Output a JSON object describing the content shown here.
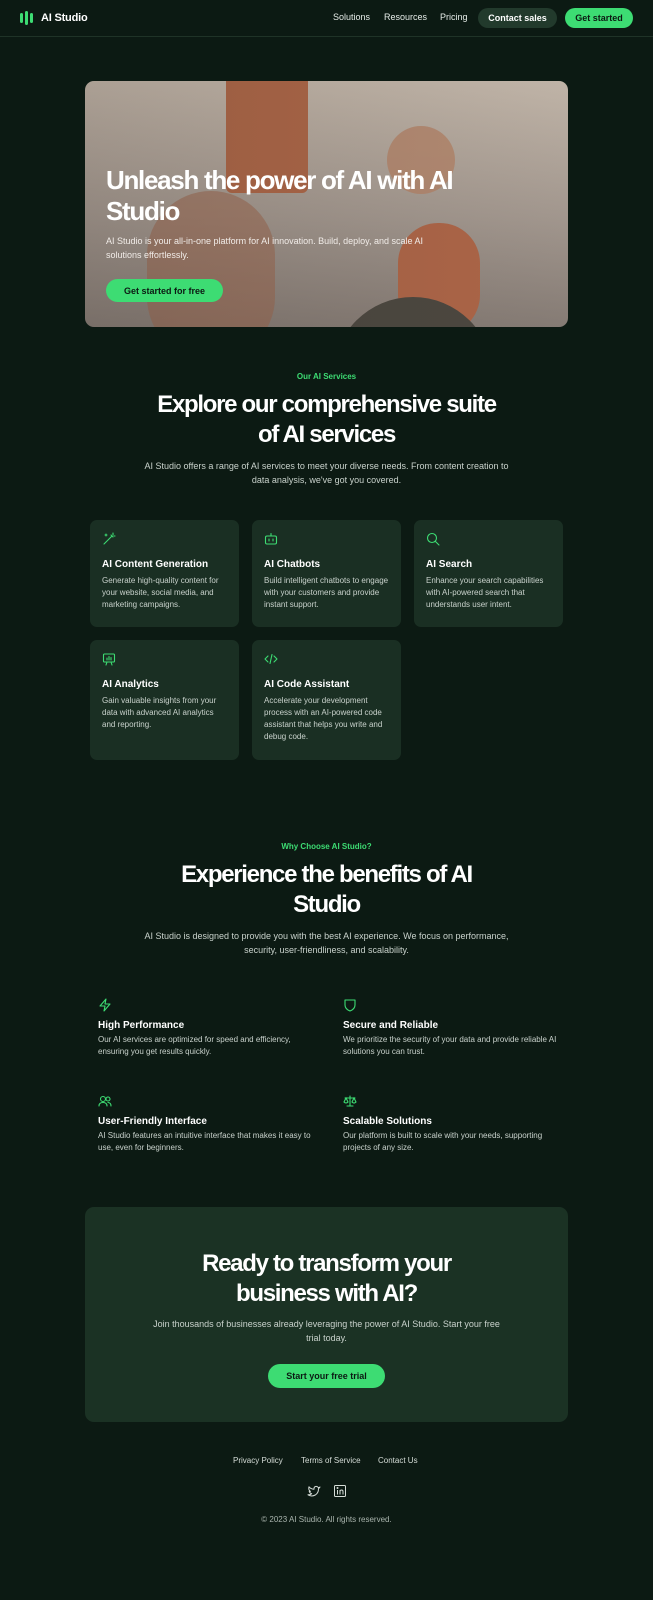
{
  "header": {
    "brand": "AI Studio",
    "nav": [
      "Solutions",
      "Resources",
      "Pricing"
    ],
    "contact_label": "Contact sales",
    "get_started_label": "Get started"
  },
  "hero": {
    "title": "Unleash the power of AI with AI Studio",
    "subtitle": "AI Studio is your all-in-one platform for AI innovation. Build, deploy, and scale AI solutions effortlessly.",
    "cta_label": "Get started for free"
  },
  "services": {
    "eyebrow": "Our AI Services",
    "title": "Explore our comprehensive suite of AI services",
    "description": "AI Studio offers a range of AI services to meet your diverse needs. From content creation to data analysis, we've got you covered.",
    "items": [
      {
        "title": "AI Content Generation",
        "description": "Generate high-quality content for your website, social media, and marketing campaigns.",
        "icon": "magic-wand-icon"
      },
      {
        "title": "AI Chatbots",
        "description": "Build intelligent chatbots to engage with your customers and provide instant support.",
        "icon": "bot-icon"
      },
      {
        "title": "AI Search",
        "description": "Enhance your search capabilities with AI-powered search that understands user intent.",
        "icon": "search-icon"
      },
      {
        "title": "AI Analytics",
        "description": "Gain valuable insights from your data with advanced AI analytics and reporting.",
        "icon": "analytics-icon"
      },
      {
        "title": "AI Code Assistant",
        "description": "Accelerate your development process with an AI-powered code assistant that helps you write and debug code.",
        "icon": "code-icon"
      }
    ]
  },
  "benefits": {
    "eyebrow": "Why Choose AI Studio?",
    "title": "Experience the benefits of AI Studio",
    "description": "AI Studio is designed to provide you with the best AI experience. We focus on performance, security, user-friendliness, and scalability.",
    "items": [
      {
        "title": "High Performance",
        "description": "Our AI services are optimized for speed and efficiency, ensuring you get results quickly.",
        "icon": "lightning-icon"
      },
      {
        "title": "Secure and Reliable",
        "description": "We prioritize the security of your data and provide reliable AI solutions you can trust.",
        "icon": "shield-icon"
      },
      {
        "title": "User-Friendly Interface",
        "description": "AI Studio features an intuitive interface that makes it easy to use, even for beginners.",
        "icon": "users-icon"
      },
      {
        "title": "Scalable Solutions",
        "description": "Our platform is built to scale with your needs, supporting projects of any size.",
        "icon": "scale-icon"
      }
    ]
  },
  "cta": {
    "title": "Ready to transform your business with AI?",
    "description": "Join thousands of businesses already leveraging the power of AI Studio. Start your free trial today.",
    "button_label": "Start your free trial"
  },
  "footer": {
    "links": [
      "Privacy Policy",
      "Terms of Service",
      "Contact Us"
    ],
    "social": [
      "twitter-icon",
      "linkedin-icon"
    ],
    "copyright": "© 2023 AI Studio. All rights reserved."
  },
  "colors": {
    "background": "#0c1a13",
    "accent": "#3ddc73",
    "card": "#1a2f23"
  }
}
